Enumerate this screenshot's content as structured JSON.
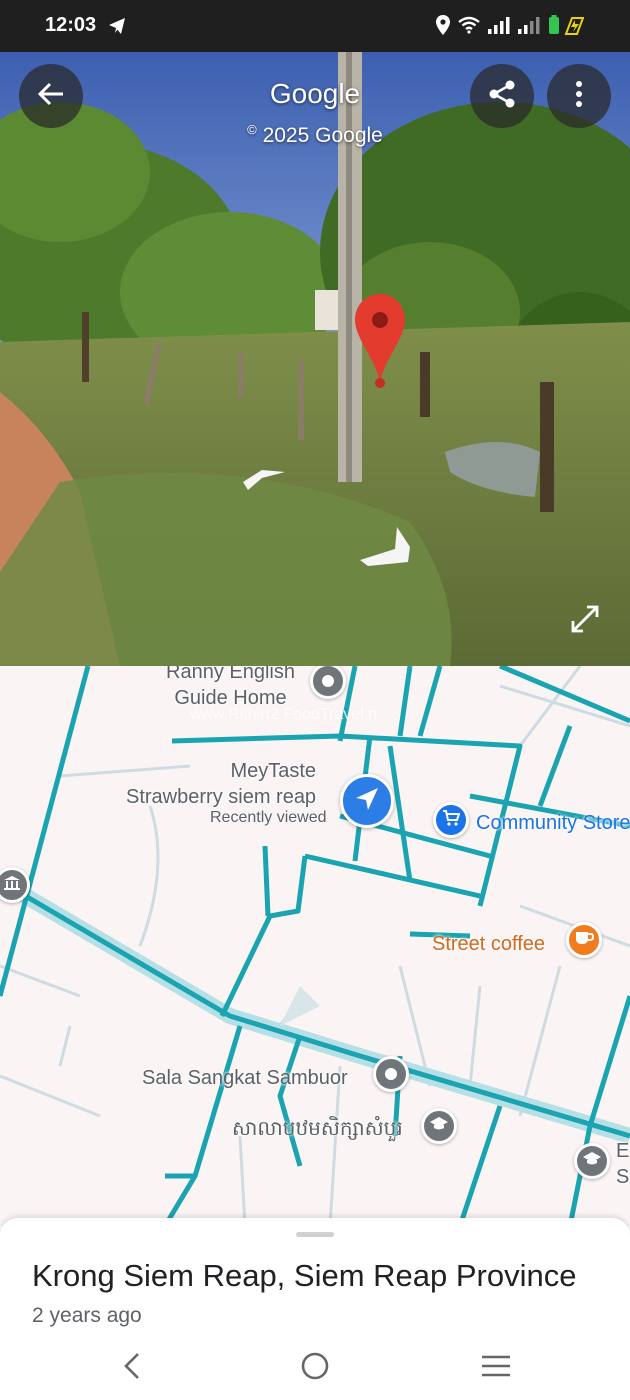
{
  "status_bar": {
    "time": "12:03",
    "icons": [
      "telegram-icon",
      "location-icon",
      "wifi-icon",
      "signal-icon",
      "signal-icon",
      "battery-icon"
    ]
  },
  "street_view": {
    "title": "Google",
    "copyright": "2025 Google",
    "buttons": [
      "back-arrow-icon",
      "share-icon",
      "more-vert-icon",
      "expand-icon"
    ]
  },
  "map": {
    "places": [
      {
        "name_line1": "Ranny English",
        "name_line2": "Guide Home"
      },
      {
        "name_line1": "MeyTaste",
        "name_line2": "Strawberry siem reap",
        "note": "Recently viewed"
      },
      {
        "name": "Community Store"
      },
      {
        "name": "Street coffee"
      },
      {
        "name": "Sala Sangkat Sambuor"
      },
      {
        "name": "សាលាបឋមសិក្សាសំបួរ"
      },
      {
        "name_line1": "E",
        "name_line2": "S"
      }
    ],
    "watermark": "www.Rithirt2 FoodTravel.n",
    "colors": {
      "road": "#1aa3b0",
      "road_major_halo": "#b6e0e6",
      "land": "#fbf4f4",
      "cafe": "#f07c1e",
      "shop": "#1a73e8",
      "poi_grey": "#70757a"
    }
  },
  "sheet": {
    "title": "Krong Siem Reap, Siem Reap Province",
    "subtitle": "2 years ago"
  },
  "nav_bar": {
    "icons": [
      "back-chevron-icon",
      "home-circle-icon",
      "recents-menu-icon"
    ]
  }
}
